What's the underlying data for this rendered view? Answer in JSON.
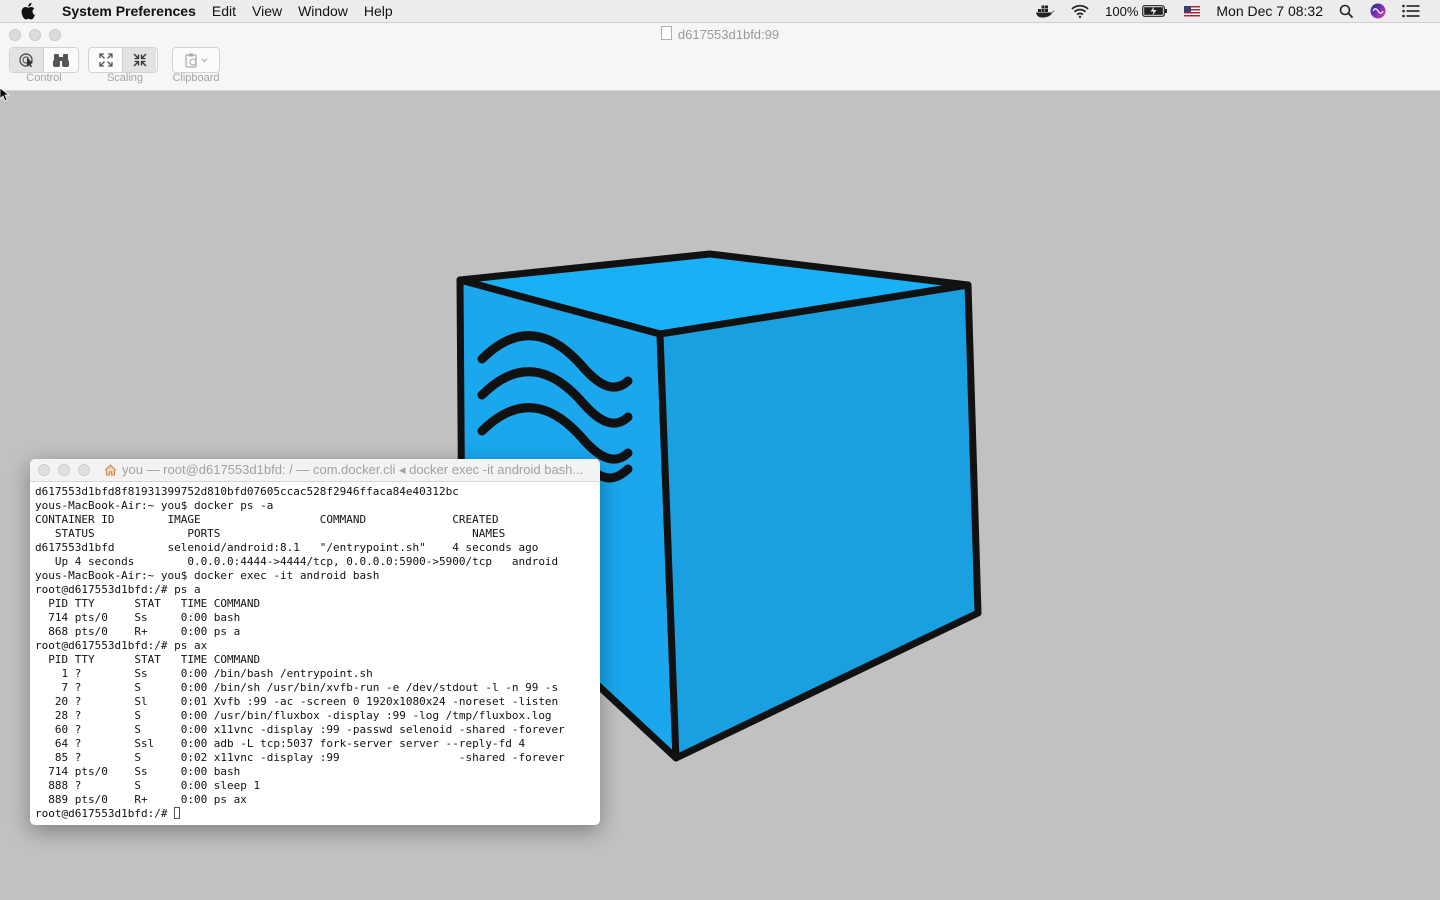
{
  "menubar": {
    "items": [
      "System Preferences",
      "Edit",
      "View",
      "Window",
      "Help"
    ],
    "battery": "100%",
    "datetime": "Mon Dec 7  08:32"
  },
  "window": {
    "title": "d617553d1bfd:99",
    "toolbar": {
      "control_label": "Control",
      "scaling_label": "Scaling",
      "clipboard_label": "Clipboard"
    }
  },
  "cube": {
    "fill_front": "#1a9fe0",
    "fill_side": "#1aa7ee",
    "fill_top": "#1ab0f5",
    "outline": "#111111"
  },
  "terminal": {
    "title": "you — root@d617553d1bfd: / — com.docker.cli ◂ docker exec -it android bash...",
    "lines": [
      "d617553d1bfd8f81931399752d810bfd07605ccac528f2946ffaca84e40312bc",
      "yous-MacBook-Air:~ you$ docker ps -a",
      "CONTAINER ID        IMAGE                  COMMAND             CREATED",
      "   STATUS              PORTS                                      NAMES",
      "d617553d1bfd        selenoid/android:8.1   \"/entrypoint.sh\"    4 seconds ago",
      "   Up 4 seconds        0.0.0.0:4444->4444/tcp, 0.0.0.0:5900->5900/tcp   android",
      "yous-MacBook-Air:~ you$ docker exec -it android bash",
      "root@d617553d1bfd:/# ps a",
      "  PID TTY      STAT   TIME COMMAND",
      "  714 pts/0    Ss     0:00 bash",
      "  868 pts/0    R+     0:00 ps a",
      "root@d617553d1bfd:/# ps ax",
      "  PID TTY      STAT   TIME COMMAND",
      "    1 ?        Ss     0:00 /bin/bash /entrypoint.sh",
      "    7 ?        S      0:00 /bin/sh /usr/bin/xvfb-run -e /dev/stdout -l -n 99 -s",
      "   20 ?        Sl     0:01 Xvfb :99 -ac -screen 0 1920x1080x24 -noreset -listen",
      "   28 ?        S      0:00 /usr/bin/fluxbox -display :99 -log /tmp/fluxbox.log",
      "   60 ?        S      0:00 x11vnc -display :99 -passwd selenoid -shared -forever",
      "   64 ?        Ssl    0:00 adb -L tcp:5037 fork-server server --reply-fd 4",
      "   85 ?        S      0:02 x11vnc -display :99                  -shared -forever",
      "  714 pts/0    Ss     0:00 bash",
      "  888 ?        S      0:00 sleep 1",
      "  889 pts/0    R+     0:00 ps ax"
    ],
    "prompt": "root@d617553d1bfd:/# "
  }
}
